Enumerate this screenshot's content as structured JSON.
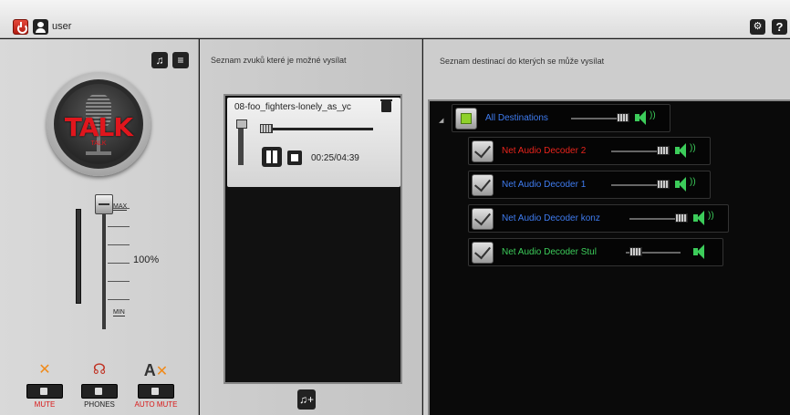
{
  "topbar": {
    "user": "user"
  },
  "left": {
    "volume_max": "MAX",
    "volume_min": "MIN",
    "volume_percent": "100%",
    "volume_level": 1.0,
    "talk_label": "TALK",
    "talk_sublabel": "TALK",
    "buttons": {
      "mute": "MUTE",
      "phones": "PHONES",
      "auto_mute": "AUTO MUTE",
      "a_letter": "A"
    }
  },
  "middle": {
    "title": "Seznam zvuků které je možné vysílat",
    "track": {
      "title": "08-foo_fighters-lonely_as_yc",
      "time": "00:25/04:39"
    }
  },
  "right": {
    "title": "Seznam destinací do kterých se může vysílat",
    "destinations": [
      {
        "label": "All Destinations",
        "color": "#3f7cf0",
        "checked": "green"
      },
      {
        "label": "Net Audio Decoder 2",
        "color": "#e8241c",
        "checked": "check"
      },
      {
        "label": "Net Audio Decoder 1",
        "color": "#3f7cf0",
        "checked": "check"
      },
      {
        "label": "Net Audio Decoder konz",
        "color": "#3f7cf0",
        "checked": "check"
      },
      {
        "label": "Net Audio Decoder Stul",
        "color": "#3ccc5a",
        "checked": "check"
      }
    ]
  },
  "colors": {
    "accent_green": "#3ccc5a",
    "accent_red": "#e0161d",
    "accent_blue": "#3f7cf0",
    "mute_orange": "#f08a1a"
  }
}
